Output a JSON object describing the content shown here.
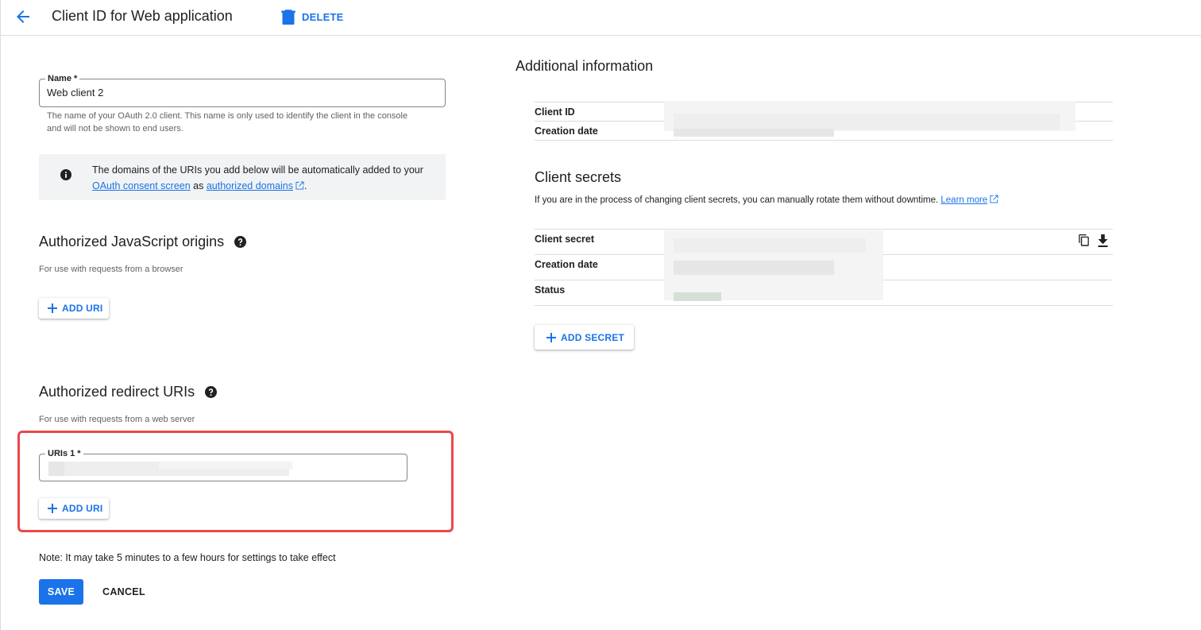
{
  "header": {
    "title": "Client ID for Web application",
    "delete_label": "DELETE"
  },
  "name_field": {
    "label": "Name *",
    "value": "Web client 2",
    "hint": "The name of your OAuth 2.0 client. This name is only used to identify the client in the console and will not be shown to end users."
  },
  "info_box": {
    "text_before": "The domains of the URIs you add below will be automatically added to your ",
    "link1": "OAuth consent screen",
    "text_mid": " as ",
    "link2": "authorized domains",
    "text_after": "."
  },
  "js_origins": {
    "title": "Authorized JavaScript origins",
    "caption": "For use with requests from a browser",
    "add_label": "ADD URI"
  },
  "redirect_uris": {
    "title": "Authorized redirect URIs",
    "caption": "For use with requests from a web server",
    "field_label": "URIs 1 *",
    "add_label": "ADD URI"
  },
  "footer": {
    "note": "Note: It may take 5 minutes to a few hours for settings to take effect",
    "save_label": "SAVE",
    "cancel_label": "CANCEL"
  },
  "additional_info": {
    "title": "Additional information",
    "client_id_key": "Client ID",
    "creation_date_key": "Creation date"
  },
  "client_secrets": {
    "title": "Client secrets",
    "description": "If you are in the process of changing client secrets, you can manually rotate them without downtime.",
    "learn_more": "Learn more",
    "secret_key": "Client secret",
    "creation_date_key": "Creation date",
    "status_key": "Status",
    "add_secret_label": "ADD SECRET"
  },
  "colors": {
    "accent": "#1a73e8",
    "highlight_border": "#e8494a"
  },
  "icons": [
    "back-arrow-icon",
    "trash-icon",
    "info-icon",
    "help-icon",
    "plus-icon",
    "external-link-icon",
    "copy-icon",
    "download-icon"
  ]
}
